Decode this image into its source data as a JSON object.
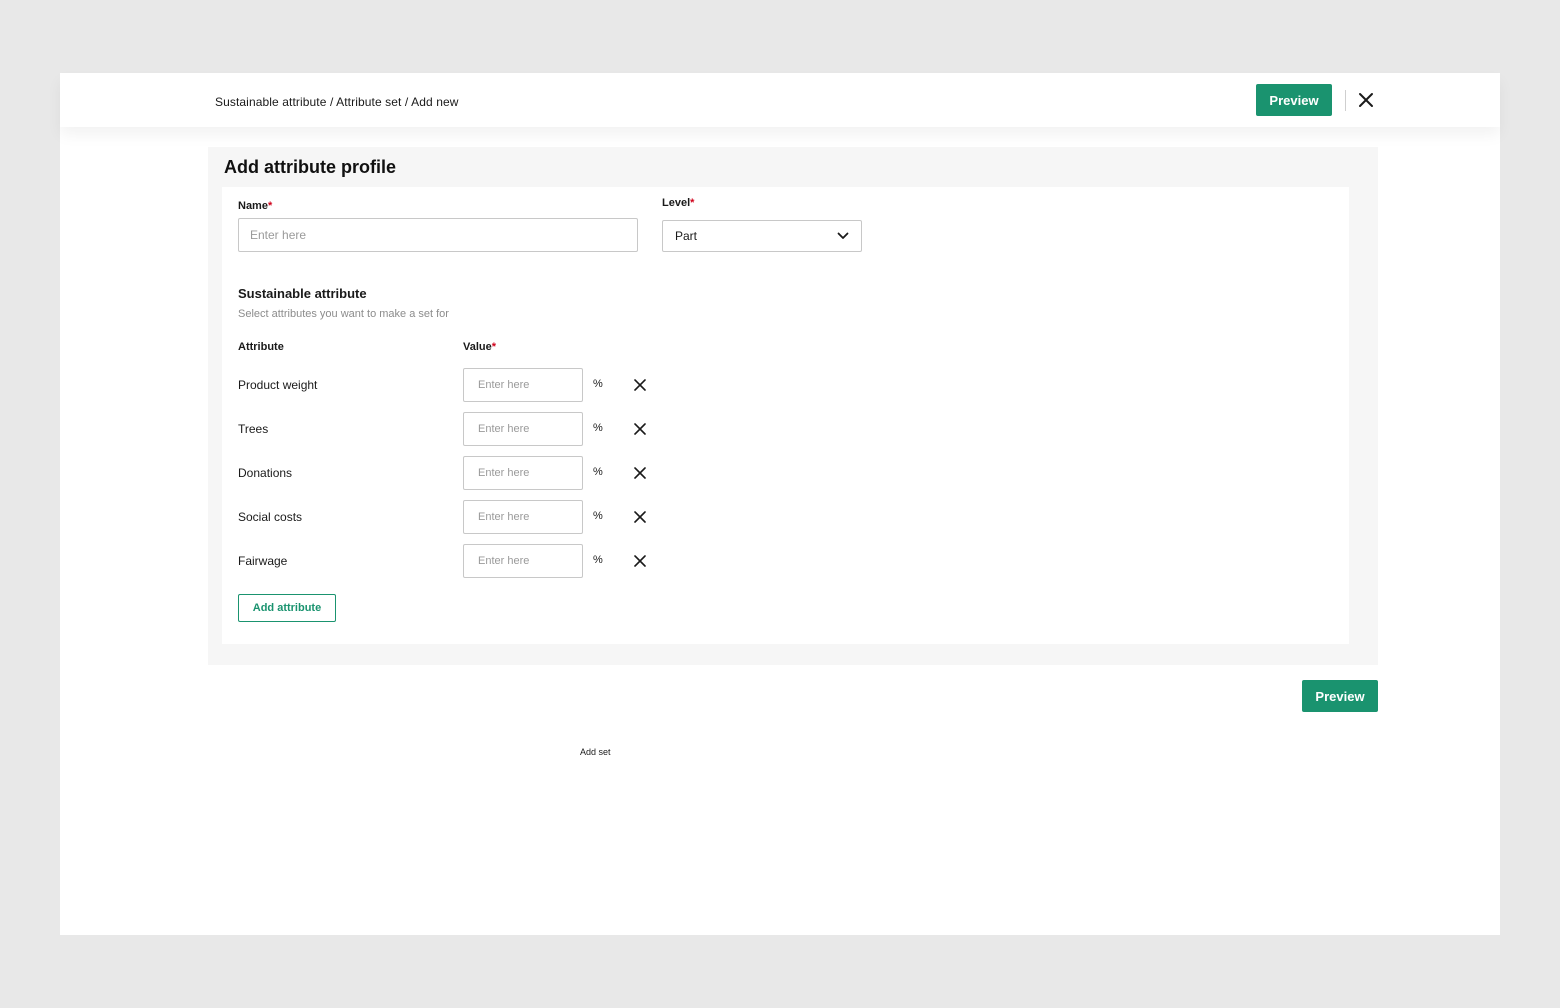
{
  "header": {
    "breadcrumb": "Sustainable attribute / Attribute set / Add new",
    "preview_label": "Preview",
    "close_icon": "close-icon"
  },
  "form": {
    "title": "Add attribute profile",
    "name": {
      "label": "Name",
      "required_mark": "*",
      "placeholder": "Enter here",
      "value": ""
    },
    "level": {
      "label": "Level",
      "required_mark": "*",
      "selected": "Part",
      "icon": "chevron-down-icon"
    },
    "attributes_section": {
      "title": "Sustainable attribute",
      "subtitle": "Select attributes you want to make a set for",
      "col_attribute": "Attribute",
      "col_value": "Value",
      "col_value_required": "*",
      "rows": [
        {
          "name": "Product weight",
          "placeholder": "Enter here",
          "unit": "%"
        },
        {
          "name": "Trees",
          "placeholder": "Enter here",
          "unit": "%"
        },
        {
          "name": "Donations",
          "placeholder": "Enter here",
          "unit": "%"
        },
        {
          "name": "Social costs",
          "placeholder": "Enter here",
          "unit": "%"
        },
        {
          "name": "Fairwage",
          "placeholder": "Enter here",
          "unit": "%"
        }
      ],
      "add_attribute_label": "Add attribute"
    }
  },
  "footer": {
    "preview_label": "Preview",
    "add_set_label": "Add set"
  },
  "colors": {
    "accent": "#1a936f",
    "required": "#d0021b",
    "background": "#e8e8e8"
  }
}
